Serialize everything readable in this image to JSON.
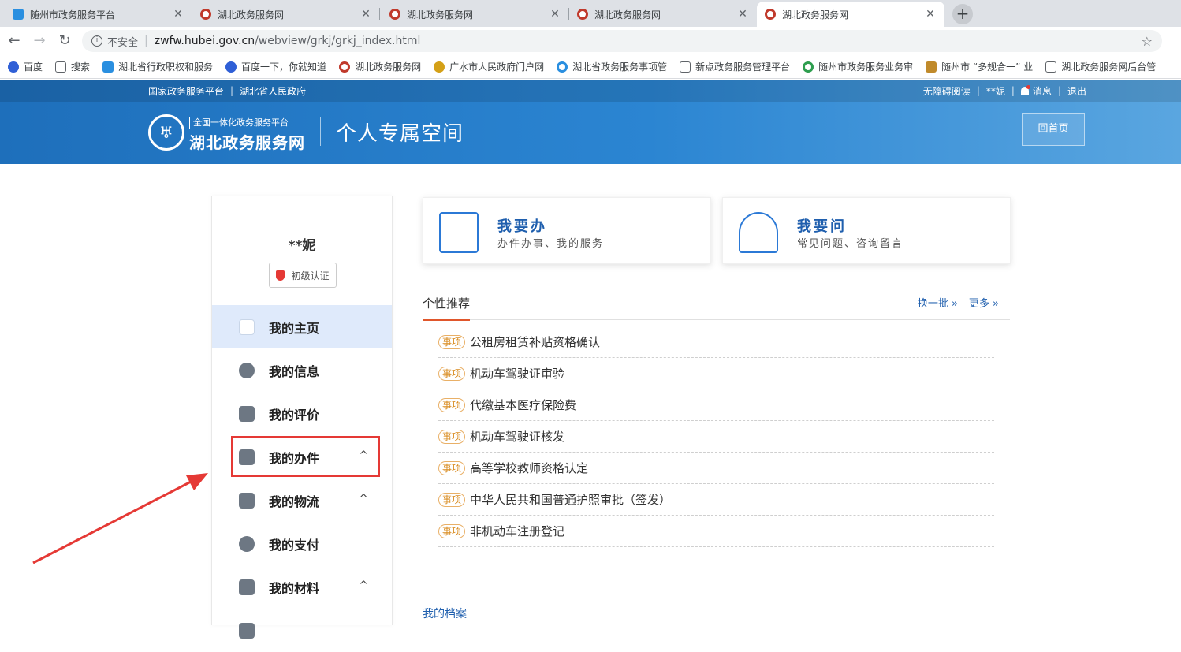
{
  "browser": {
    "tabs": [
      {
        "label": "随州市政务服务平台",
        "icon": "cloud-favicon"
      },
      {
        "label": "湖北政务服务网",
        "icon": "seal-favicon"
      },
      {
        "label": "湖北政务服务网",
        "icon": "seal-favicon"
      },
      {
        "label": "湖北政务服务网",
        "icon": "seal-favicon"
      },
      {
        "label": "湖北政务服务网",
        "icon": "seal-favicon"
      }
    ],
    "active_tab": 4,
    "security_label": "不安全",
    "url_host": "zwfw.hubei.gov.cn",
    "url_path": "/webview/grkj/grkj_index.html",
    "bookmarks": [
      {
        "label": "百度",
        "color": "#2f5fd6"
      },
      {
        "label": "搜索",
        "color": "#ffffff"
      },
      {
        "label": "湖北省行政职权和服务",
        "color": "#2a8fe0"
      },
      {
        "label": "百度一下，你就知道",
        "color": "#ffffff"
      },
      {
        "label": "湖北政务服务网",
        "color": "#c0392b"
      },
      {
        "label": "广水市人民政府门户网",
        "color": "#d4a017"
      },
      {
        "label": "湖北省政务服务事项管",
        "color": "#2a8fe0"
      },
      {
        "label": "新点政务服务管理平台",
        "color": "#ffffff"
      },
      {
        "label": "随州市政务服务业务审",
        "color": "#2e9e4f"
      },
      {
        "label": "随州市 “多规合一” 业",
        "color": "#c08a2b"
      },
      {
        "label": "湖北政务服务网后台管",
        "color": "#ffffff"
      }
    ]
  },
  "header": {
    "top_left": [
      "国家政务服务平台",
      "湖北省人民政府"
    ],
    "accessibility": "无障碍阅读",
    "user": "**妮",
    "messages": "消息",
    "logout": "退出",
    "logo_sub": "全国一体化政务服务平台",
    "logo_main": "湖北政务服务网",
    "page_title": "个人专属空间",
    "home_button": "回首页"
  },
  "sidebar": {
    "username": "**妮",
    "auth_level": "初级认证",
    "items": [
      {
        "label": "我的主页",
        "icon": "home-icon",
        "active": true,
        "caret": false
      },
      {
        "label": "我的信息",
        "icon": "message-icon",
        "active": false,
        "caret": false
      },
      {
        "label": "我的评价",
        "icon": "edit-icon",
        "active": false,
        "caret": false
      },
      {
        "label": "我的办件",
        "icon": "document-icon",
        "active": false,
        "caret": true
      },
      {
        "label": "我的物流",
        "icon": "package-icon",
        "active": false,
        "caret": true
      },
      {
        "label": "我的支付",
        "icon": "yen-icon",
        "active": false,
        "caret": false
      },
      {
        "label": "我的材料",
        "icon": "folder-icon",
        "active": false,
        "caret": true
      }
    ],
    "caret_glyph": "^"
  },
  "cards": [
    {
      "title": "我要办",
      "subtitle": "办件办事、我的服务",
      "icon": "handle-affairs-icon"
    },
    {
      "title": "我要问",
      "subtitle": "常见问题、咨询留言",
      "icon": "consult-icon"
    }
  ],
  "recommend": {
    "title": "个性推荐",
    "refresh": "换一批 »",
    "more": "更多 »",
    "tag": "事项",
    "items": [
      "公租房租赁补贴资格确认",
      "机动车驾驶证审验",
      "代缴基本医疗保险费",
      "机动车驾驶证核发",
      "高等学校教师资格认定",
      "中华人民共和国普通护照审批（签发）",
      "非机动车注册登记"
    ]
  },
  "archive_link": "我的档案",
  "colors": {
    "brand_blue": "#1f5fae",
    "header_blue": "#1e6fbb",
    "active_menu_bg": "#dfeafb",
    "tag_orange": "#d98c21",
    "annotation_red": "#e53935"
  }
}
